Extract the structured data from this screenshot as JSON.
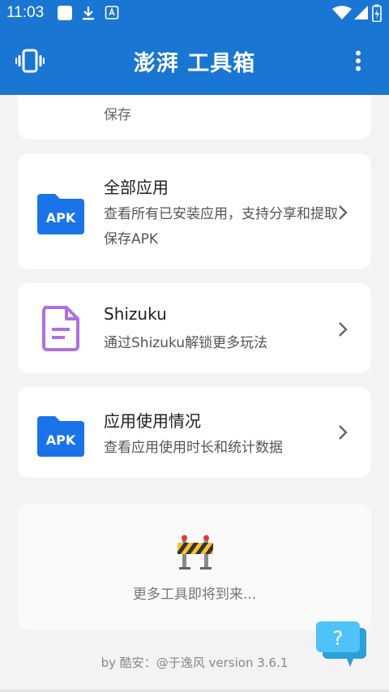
{
  "status_bar": {
    "time": "11:03"
  },
  "app_bar": {
    "title": "澎湃 工具箱"
  },
  "cards": {
    "partial_label": "保存",
    "all_apps": {
      "title": "全部应用",
      "desc": "查看所有已安装应用，支持分享和提取保存APK",
      "icon_text": "APK"
    },
    "shizuku": {
      "title": "Shizuku",
      "desc": "通过Shizuku解锁更多玩法"
    },
    "usage": {
      "title": "应用使用情况",
      "desc": "查看应用使用时长和统计数据",
      "icon_text": "APK"
    }
  },
  "coming_soon": {
    "text": "更多工具即将到来..."
  },
  "footer": {
    "text": "by 酷安：@于逸风 version 3.6.1"
  },
  "help_button": {
    "label": "?"
  },
  "colors": {
    "primary": "#1976d2",
    "apk_blue": "#1a73e8",
    "shizuku_purple": "#b070e0",
    "help_bubble": "#4fc3f7"
  }
}
